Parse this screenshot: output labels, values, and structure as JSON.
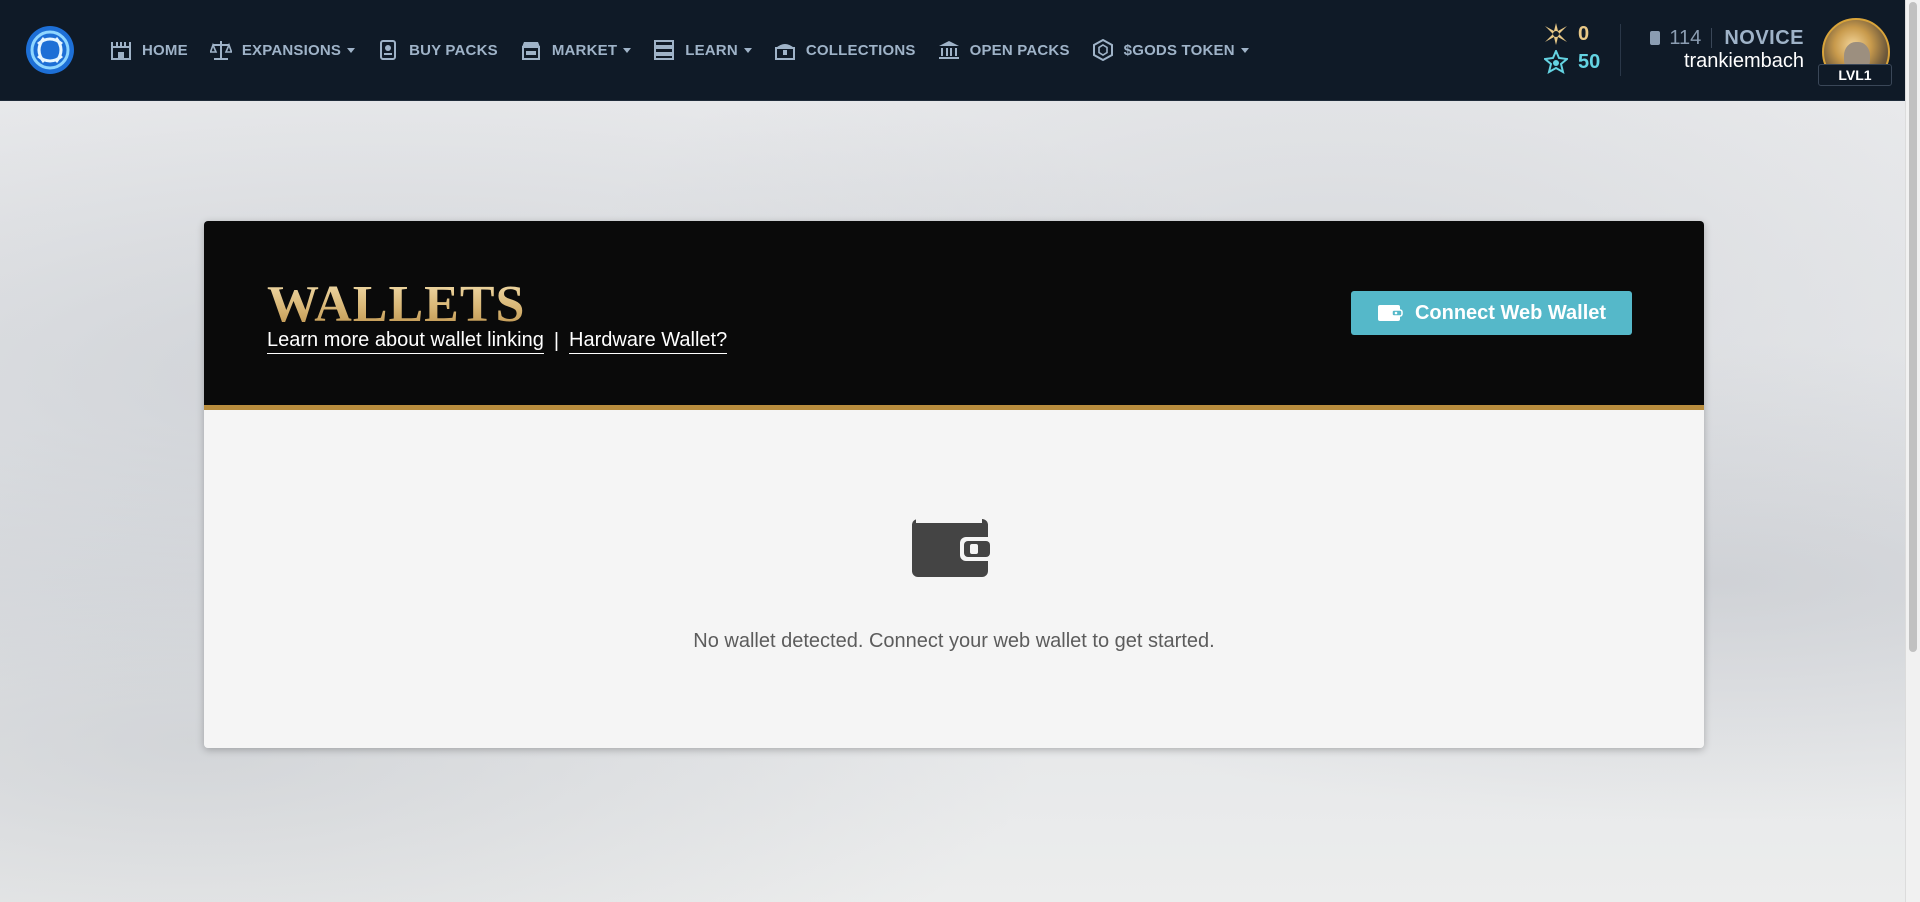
{
  "nav": {
    "items": [
      {
        "label": "HOME",
        "icon": "home-icon",
        "caret": false
      },
      {
        "label": "EXPANSIONS",
        "icon": "scales-icon",
        "caret": true
      },
      {
        "label": "BUY PACKS",
        "icon": "pack-icon",
        "caret": false
      },
      {
        "label": "MARKET",
        "icon": "market-icon",
        "caret": true
      },
      {
        "label": "LEARN",
        "icon": "learn-icon",
        "caret": true
      },
      {
        "label": "COLLECTIONS",
        "icon": "chest-icon",
        "caret": false
      },
      {
        "label": "OPEN PACKS",
        "icon": "bank-icon",
        "caret": false
      },
      {
        "label": "$GODS TOKEN",
        "icon": "token-icon",
        "caret": true
      }
    ]
  },
  "currency": {
    "flux": "0",
    "star": "50"
  },
  "user": {
    "cards": "114",
    "rank": "NOVICE",
    "username": "trankiembach",
    "level": "LVL1"
  },
  "wallets": {
    "title": "WALLETS",
    "learn_link": "Learn more about wallet linking",
    "separator": "|",
    "hardware_link": "Hardware Wallet?",
    "connect_button": "Connect Web Wallet",
    "empty_message": "No wallet detected. Connect your web wallet to get started."
  },
  "colors": {
    "header_bg": "#0f1a27",
    "nav_text": "#9fb3c8",
    "accent_gold": "#b98d3e",
    "button_teal": "#55b8c9"
  }
}
